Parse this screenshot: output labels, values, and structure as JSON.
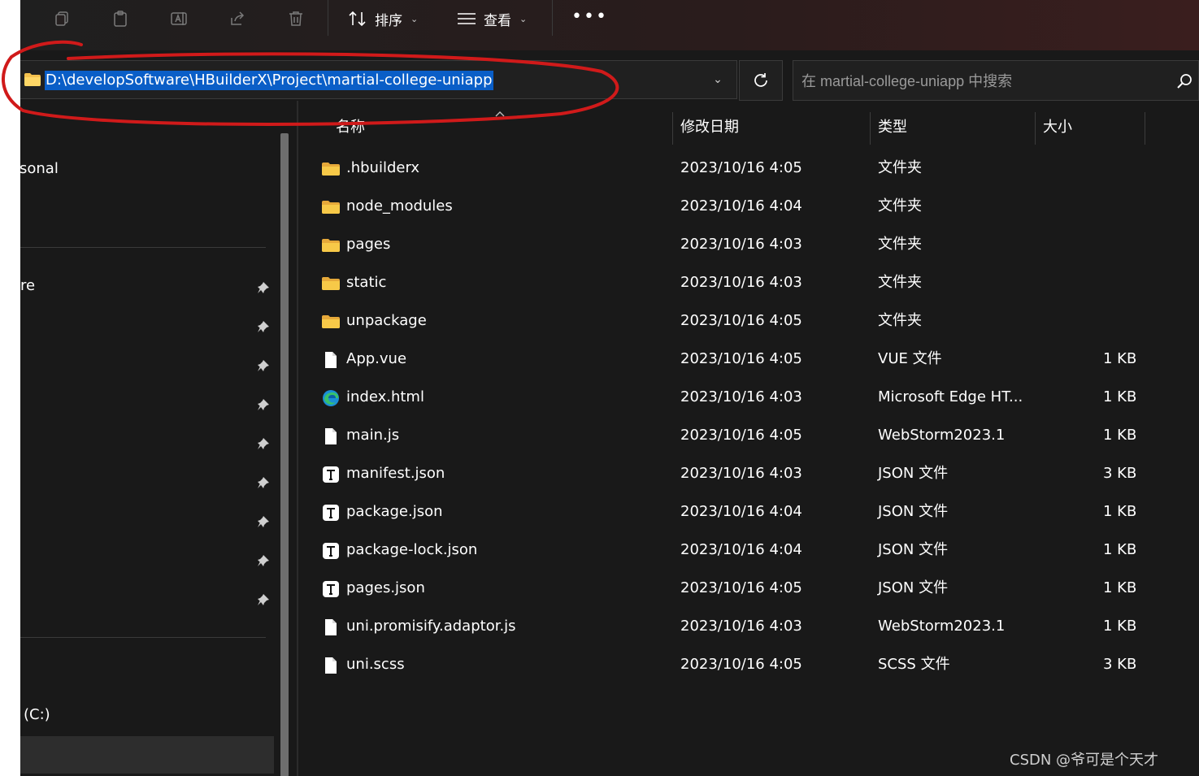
{
  "toolbar": {
    "sort_label": "排序",
    "view_label": "查看",
    "more_label": "•••"
  },
  "address": {
    "path": "D:\\developSoftware\\HBuilderX\\Project\\martial-college-uniapp"
  },
  "search": {
    "placeholder": "在 martial-college-uniapp 中搜索"
  },
  "nav": {
    "items": [
      {
        "label": "sonal"
      },
      {
        "label": "re"
      },
      {
        "label": "(C:)"
      }
    ]
  },
  "columns": {
    "name": "名称",
    "date": "修改日期",
    "type": "类型",
    "size": "大小"
  },
  "files": [
    {
      "name": ".hbuilderx",
      "date": "2023/10/16 4:05",
      "type": "文件夹",
      "size": "",
      "icon": "folder-icon"
    },
    {
      "name": "node_modules",
      "date": "2023/10/16 4:04",
      "type": "文件夹",
      "size": "",
      "icon": "folder-icon"
    },
    {
      "name": "pages",
      "date": "2023/10/16 4:03",
      "type": "文件夹",
      "size": "",
      "icon": "folder-icon"
    },
    {
      "name": "static",
      "date": "2023/10/16 4:03",
      "type": "文件夹",
      "size": "",
      "icon": "folder-icon"
    },
    {
      "name": "unpackage",
      "date": "2023/10/16 4:05",
      "type": "文件夹",
      "size": "",
      "icon": "folder-icon"
    },
    {
      "name": "App.vue",
      "date": "2023/10/16 4:05",
      "type": "VUE 文件",
      "size": "1 KB",
      "icon": "file-icon"
    },
    {
      "name": "index.html",
      "date": "2023/10/16 4:03",
      "type": "Microsoft Edge HT...",
      "size": "1 KB",
      "icon": "edge-icon"
    },
    {
      "name": "main.js",
      "date": "2023/10/16 4:05",
      "type": "WebStorm2023.1",
      "size": "1 KB",
      "icon": "file-icon"
    },
    {
      "name": "manifest.json",
      "date": "2023/10/16 4:03",
      "type": "JSON 文件",
      "size": "3 KB",
      "icon": "text-file-icon"
    },
    {
      "name": "package.json",
      "date": "2023/10/16 4:04",
      "type": "JSON 文件",
      "size": "1 KB",
      "icon": "text-file-icon"
    },
    {
      "name": "package-lock.json",
      "date": "2023/10/16 4:04",
      "type": "JSON 文件",
      "size": "1 KB",
      "icon": "text-file-icon"
    },
    {
      "name": "pages.json",
      "date": "2023/10/16 4:05",
      "type": "JSON 文件",
      "size": "1 KB",
      "icon": "text-file-icon"
    },
    {
      "name": "uni.promisify.adaptor.js",
      "date": "2023/10/16 4:03",
      "type": "WebStorm2023.1",
      "size": "1 KB",
      "icon": "file-icon"
    },
    {
      "name": "uni.scss",
      "date": "2023/10/16 4:05",
      "type": "SCSS 文件",
      "size": "3 KB",
      "icon": "file-icon"
    }
  ],
  "watermark": "CSDN @爷可是个天才",
  "colors": {
    "background": "#191919",
    "selection": "#0a5ec7",
    "folder": "#f4c14e",
    "annotation": "#d01a1a"
  }
}
